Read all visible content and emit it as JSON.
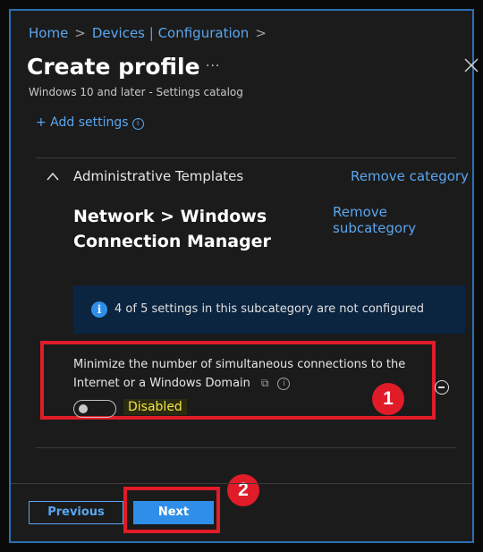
{
  "breadcrumb": {
    "home": "Home",
    "devices": "Devices | Configuration",
    "separator": ">"
  },
  "header": {
    "title": "Create profile",
    "more": "···",
    "subtitle": "Windows 10 and later - Settings catalog"
  },
  "add_settings": {
    "label": "+ Add settings",
    "info": "i"
  },
  "category": {
    "name": "Administrative Templates",
    "remove_category": "Remove category",
    "subcategory": "Network > Windows Connection Manager",
    "remove_subcategory": "Remove subcategory"
  },
  "notice": {
    "icon_text": "i",
    "text": "4 of 5 settings in this subcategory are not configured"
  },
  "setting": {
    "label": "Minimize the number of simultaneous connections to the Internet or a Windows Domain",
    "info": "i",
    "copy": "⧉",
    "toggle_state": "off",
    "state_label": "Disabled"
  },
  "callouts": {
    "one": "1",
    "two": "2"
  },
  "footer": {
    "previous": "Previous",
    "next": "Next"
  },
  "colors": {
    "accent": "#5aa6ef",
    "primary_button": "#2f8fe8",
    "highlight": "#e01c28",
    "frame": "#2b6fb1"
  }
}
